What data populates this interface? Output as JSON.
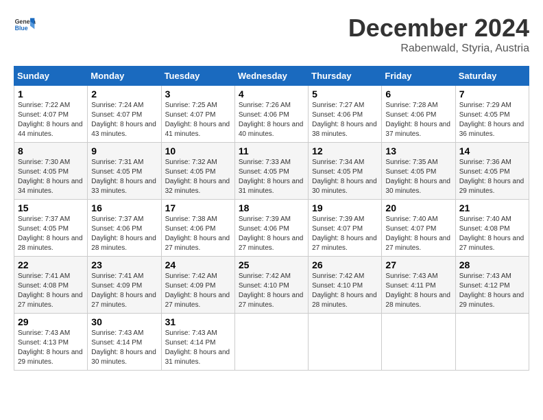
{
  "logo": {
    "text_general": "General",
    "text_blue": "Blue"
  },
  "title": "December 2024",
  "subtitle": "Rabenwald, Styria, Austria",
  "days_of_week": [
    "Sunday",
    "Monday",
    "Tuesday",
    "Wednesday",
    "Thursday",
    "Friday",
    "Saturday"
  ],
  "weeks": [
    [
      {
        "day": "1",
        "sunrise": "7:22 AM",
        "sunset": "4:07 PM",
        "daylight": "8 hours and 44 minutes."
      },
      {
        "day": "2",
        "sunrise": "7:24 AM",
        "sunset": "4:07 PM",
        "daylight": "8 hours and 43 minutes."
      },
      {
        "day": "3",
        "sunrise": "7:25 AM",
        "sunset": "4:07 PM",
        "daylight": "8 hours and 41 minutes."
      },
      {
        "day": "4",
        "sunrise": "7:26 AM",
        "sunset": "4:06 PM",
        "daylight": "8 hours and 40 minutes."
      },
      {
        "day": "5",
        "sunrise": "7:27 AM",
        "sunset": "4:06 PM",
        "daylight": "8 hours and 38 minutes."
      },
      {
        "day": "6",
        "sunrise": "7:28 AM",
        "sunset": "4:06 PM",
        "daylight": "8 hours and 37 minutes."
      },
      {
        "day": "7",
        "sunrise": "7:29 AM",
        "sunset": "4:05 PM",
        "daylight": "8 hours and 36 minutes."
      }
    ],
    [
      {
        "day": "8",
        "sunrise": "7:30 AM",
        "sunset": "4:05 PM",
        "daylight": "8 hours and 34 minutes."
      },
      {
        "day": "9",
        "sunrise": "7:31 AM",
        "sunset": "4:05 PM",
        "daylight": "8 hours and 33 minutes."
      },
      {
        "day": "10",
        "sunrise": "7:32 AM",
        "sunset": "4:05 PM",
        "daylight": "8 hours and 32 minutes."
      },
      {
        "day": "11",
        "sunrise": "7:33 AM",
        "sunset": "4:05 PM",
        "daylight": "8 hours and 31 minutes."
      },
      {
        "day": "12",
        "sunrise": "7:34 AM",
        "sunset": "4:05 PM",
        "daylight": "8 hours and 30 minutes."
      },
      {
        "day": "13",
        "sunrise": "7:35 AM",
        "sunset": "4:05 PM",
        "daylight": "8 hours and 30 minutes."
      },
      {
        "day": "14",
        "sunrise": "7:36 AM",
        "sunset": "4:05 PM",
        "daylight": "8 hours and 29 minutes."
      }
    ],
    [
      {
        "day": "15",
        "sunrise": "7:37 AM",
        "sunset": "4:05 PM",
        "daylight": "8 hours and 28 minutes."
      },
      {
        "day": "16",
        "sunrise": "7:37 AM",
        "sunset": "4:06 PM",
        "daylight": "8 hours and 28 minutes."
      },
      {
        "day": "17",
        "sunrise": "7:38 AM",
        "sunset": "4:06 PM",
        "daylight": "8 hours and 27 minutes."
      },
      {
        "day": "18",
        "sunrise": "7:39 AM",
        "sunset": "4:06 PM",
        "daylight": "8 hours and 27 minutes."
      },
      {
        "day": "19",
        "sunrise": "7:39 AM",
        "sunset": "4:07 PM",
        "daylight": "8 hours and 27 minutes."
      },
      {
        "day": "20",
        "sunrise": "7:40 AM",
        "sunset": "4:07 PM",
        "daylight": "8 hours and 27 minutes."
      },
      {
        "day": "21",
        "sunrise": "7:40 AM",
        "sunset": "4:08 PM",
        "daylight": "8 hours and 27 minutes."
      }
    ],
    [
      {
        "day": "22",
        "sunrise": "7:41 AM",
        "sunset": "4:08 PM",
        "daylight": "8 hours and 27 minutes."
      },
      {
        "day": "23",
        "sunrise": "7:41 AM",
        "sunset": "4:09 PM",
        "daylight": "8 hours and 27 minutes."
      },
      {
        "day": "24",
        "sunrise": "7:42 AM",
        "sunset": "4:09 PM",
        "daylight": "8 hours and 27 minutes."
      },
      {
        "day": "25",
        "sunrise": "7:42 AM",
        "sunset": "4:10 PM",
        "daylight": "8 hours and 27 minutes."
      },
      {
        "day": "26",
        "sunrise": "7:42 AM",
        "sunset": "4:10 PM",
        "daylight": "8 hours and 28 minutes."
      },
      {
        "day": "27",
        "sunrise": "7:43 AM",
        "sunset": "4:11 PM",
        "daylight": "8 hours and 28 minutes."
      },
      {
        "day": "28",
        "sunrise": "7:43 AM",
        "sunset": "4:12 PM",
        "daylight": "8 hours and 29 minutes."
      }
    ],
    [
      {
        "day": "29",
        "sunrise": "7:43 AM",
        "sunset": "4:13 PM",
        "daylight": "8 hours and 29 minutes."
      },
      {
        "day": "30",
        "sunrise": "7:43 AM",
        "sunset": "4:14 PM",
        "daylight": "8 hours and 30 minutes."
      },
      {
        "day": "31",
        "sunrise": "7:43 AM",
        "sunset": "4:14 PM",
        "daylight": "8 hours and 31 minutes."
      },
      null,
      null,
      null,
      null
    ]
  ]
}
